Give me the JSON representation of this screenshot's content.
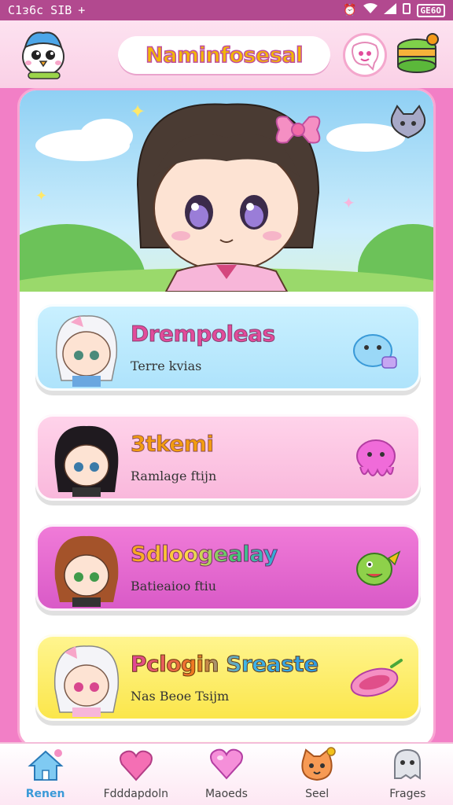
{
  "status_bar": {
    "left_text": "C1ᴈ6c SIB",
    "plus": "+",
    "battery": "GE6O"
  },
  "header": {
    "title": "Naminfosesal"
  },
  "cards": [
    {
      "title": "Drempoleas",
      "subtitle": "Terre kvias"
    },
    {
      "title": "3tkemi",
      "subtitle": "Ramlage ftijn"
    },
    {
      "title": "Sdloogealay",
      "subtitle": "Batieaioo ftiu"
    },
    {
      "title": "Pclogin Sreaste",
      "subtitle": "Nas Beoe Tsijm"
    }
  ],
  "bottom_nav": {
    "items": [
      {
        "label": "Renen",
        "icon": "home-icon",
        "active": true
      },
      {
        "label": "Fdddapdoln",
        "icon": "heart-icon"
      },
      {
        "label": "Maoeds",
        "icon": "heart-balloon-icon"
      },
      {
        "label": "Seel",
        "icon": "cat-face-icon"
      },
      {
        "label": "Frages",
        "icon": "ghost-icon"
      }
    ]
  },
  "colors": {
    "accent": "#f27fc6",
    "status_bar": "#b2498f",
    "active_nav": "#3a9ad8"
  }
}
